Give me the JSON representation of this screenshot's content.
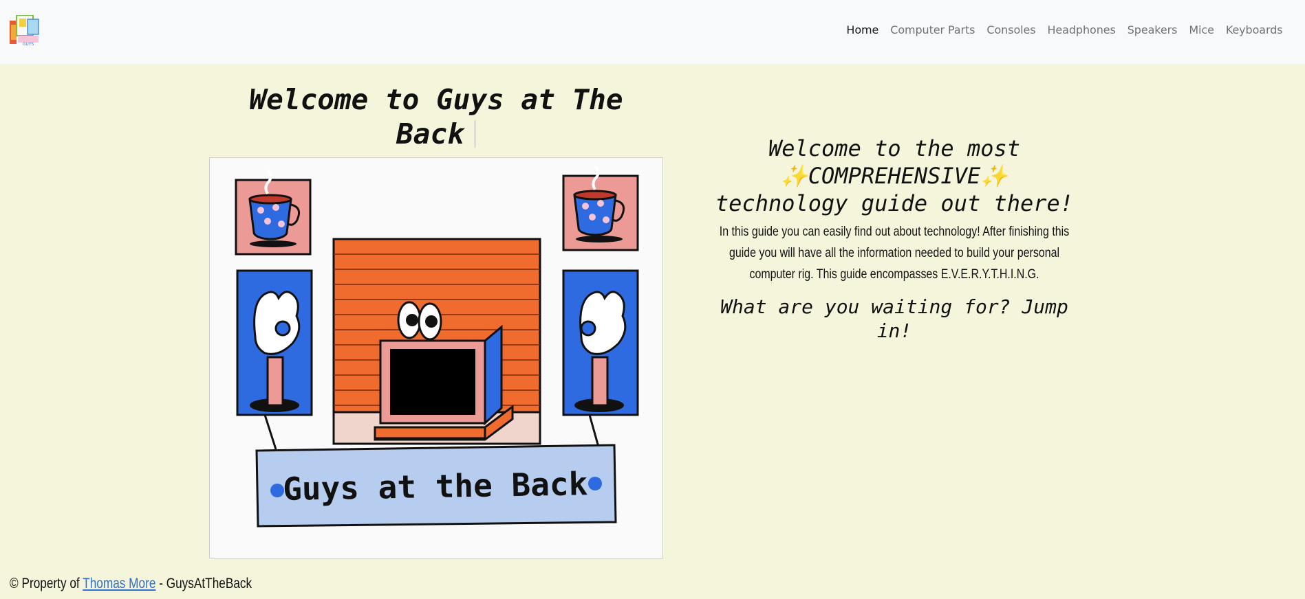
{
  "header": {
    "logo_icon": "guys-at-the-back-logo",
    "nav": [
      {
        "label": "Home",
        "active": true
      },
      {
        "label": "Computer Parts"
      },
      {
        "label": "Consoles"
      },
      {
        "label": "Headphones"
      },
      {
        "label": "Speakers"
      },
      {
        "label": "Mice"
      },
      {
        "label": "Keyboards"
      }
    ]
  },
  "hero": {
    "title": "Welcome to Guys at The Back",
    "image_banner_text": "Guys at the Back"
  },
  "intro": {
    "heading_line1": "Welcome to the most",
    "heading_line2": "✨COMPREHENSIVE✨",
    "heading_line3": "technology guide out there!",
    "paragraph": "In this guide you can easily find out about technology! After finishing this guide you will have all the information needed to build your personal computer rig. This guide encompasses E.V.E.R.Y.T.H.I.N.G.",
    "cta": "What are you waiting for? Jump in!"
  },
  "footer": {
    "prefix": "© Property of ",
    "link": "Thomas More",
    "suffix": " - GuysAtTheBack"
  },
  "colors": {
    "page_bg": "#f5f5dc",
    "navbar_bg": "#f8f9fa",
    "brick": "#ef6c2e",
    "blue_panel": "#2f6be0",
    "pink_panel": "#ec9a95",
    "banner_bg": "#b6cdf0"
  }
}
